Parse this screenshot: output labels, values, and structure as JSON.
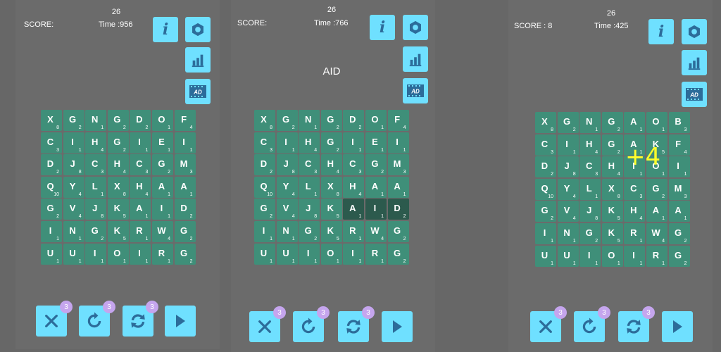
{
  "screens": [
    {
      "level": "26",
      "score": "SCORE:",
      "time": "Time :956",
      "word": "",
      "badges": {
        "clear": "3",
        "undo": "3",
        "shuffle": "3"
      },
      "grid": [
        [
          [
            "X",
            "8"
          ],
          [
            "G",
            "2"
          ],
          [
            "N",
            "1"
          ],
          [
            "G",
            "2"
          ],
          [
            "D",
            "2"
          ],
          [
            "O",
            "1"
          ],
          [
            "F",
            "4"
          ]
        ],
        [
          [
            "C",
            "3"
          ],
          [
            "I",
            "1"
          ],
          [
            "H",
            "4"
          ],
          [
            "G",
            "2"
          ],
          [
            "I",
            "1"
          ],
          [
            "E",
            "1"
          ],
          [
            "I",
            "1"
          ]
        ],
        [
          [
            "D",
            "2"
          ],
          [
            "J",
            "8"
          ],
          [
            "C",
            "3"
          ],
          [
            "H",
            "4"
          ],
          [
            "C",
            "3"
          ],
          [
            "G",
            "2"
          ],
          [
            "M",
            "3"
          ]
        ],
        [
          [
            "Q",
            "10"
          ],
          [
            "Y",
            "4"
          ],
          [
            "L",
            "1"
          ],
          [
            "X",
            "8"
          ],
          [
            "H",
            "4"
          ],
          [
            "A",
            "1"
          ],
          [
            "A",
            "1"
          ]
        ],
        [
          [
            "G",
            "2"
          ],
          [
            "V",
            "4"
          ],
          [
            "J",
            "8"
          ],
          [
            "K",
            "5"
          ],
          [
            "A",
            "1"
          ],
          [
            "I",
            "1"
          ],
          [
            "D",
            "2"
          ]
        ],
        [
          [
            "I",
            "1"
          ],
          [
            "N",
            "1"
          ],
          [
            "G",
            "2"
          ],
          [
            "K",
            "5"
          ],
          [
            "R",
            "1"
          ],
          [
            "W",
            "4"
          ],
          [
            "G",
            "2"
          ]
        ],
        [
          [
            "U",
            "1"
          ],
          [
            "U",
            "1"
          ],
          [
            "I",
            "1"
          ],
          [
            "O",
            "1"
          ],
          [
            "I",
            "1"
          ],
          [
            "R",
            "1"
          ],
          [
            "G",
            "2"
          ]
        ]
      ]
    },
    {
      "level": "26",
      "score": "SCORE:",
      "time": "Time :766",
      "word": "AID",
      "badges": {
        "clear": "3",
        "undo": "3",
        "shuffle": "3"
      },
      "grid": [
        [
          [
            "X",
            "8"
          ],
          [
            "G",
            "2"
          ],
          [
            "N",
            "1"
          ],
          [
            "G",
            "2"
          ],
          [
            "D",
            "2"
          ],
          [
            "O",
            "1"
          ],
          [
            "F",
            "4"
          ]
        ],
        [
          [
            "C",
            "3"
          ],
          [
            "I",
            "1"
          ],
          [
            "H",
            "4"
          ],
          [
            "G",
            "2"
          ],
          [
            "I",
            "1"
          ],
          [
            "E",
            "1"
          ],
          [
            "I",
            "1"
          ]
        ],
        [
          [
            "D",
            "2"
          ],
          [
            "J",
            "8"
          ],
          [
            "C",
            "3"
          ],
          [
            "H",
            "4"
          ],
          [
            "C",
            "3"
          ],
          [
            "G",
            "2"
          ],
          [
            "M",
            "3"
          ]
        ],
        [
          [
            "Q",
            "10"
          ],
          [
            "Y",
            "4"
          ],
          [
            "L",
            "1"
          ],
          [
            "X",
            "8"
          ],
          [
            "H",
            "4"
          ],
          [
            "A",
            "1"
          ],
          [
            "A",
            "1"
          ]
        ],
        [
          [
            "G",
            "2"
          ],
          [
            "V",
            "4"
          ],
          [
            "J",
            "8"
          ],
          [
            "K",
            "5"
          ],
          [
            "A",
            "1",
            1
          ],
          [
            "I",
            "1",
            1
          ],
          [
            "D",
            "2",
            1
          ]
        ],
        [
          [
            "I",
            "1"
          ],
          [
            "N",
            "1"
          ],
          [
            "G",
            "2"
          ],
          [
            "K",
            "5"
          ],
          [
            "R",
            "1"
          ],
          [
            "W",
            "4"
          ],
          [
            "G",
            "2"
          ]
        ],
        [
          [
            "U",
            "1"
          ],
          [
            "U",
            "1"
          ],
          [
            "I",
            "1"
          ],
          [
            "O",
            "1"
          ],
          [
            "I",
            "1"
          ],
          [
            "R",
            "1"
          ],
          [
            "G",
            "2"
          ]
        ]
      ]
    },
    {
      "level": "26",
      "score": "SCORE : 8",
      "time": "Time :425",
      "word": "",
      "plus_text": "+4",
      "badges": {
        "clear": "3",
        "undo": "3",
        "shuffle": "3"
      },
      "grid": [
        [
          [
            "X",
            "8"
          ],
          [
            "G",
            "2"
          ],
          [
            "N",
            "1"
          ],
          [
            "G",
            "2"
          ],
          [
            "A",
            "1"
          ],
          [
            "O",
            "1"
          ],
          [
            "B",
            "3"
          ]
        ],
        [
          [
            "C",
            "3"
          ],
          [
            "I",
            "1"
          ],
          [
            "H",
            "4"
          ],
          [
            "G",
            "2"
          ],
          [
            "A",
            "1"
          ],
          [
            "K",
            "5"
          ],
          [
            "F",
            "4"
          ]
        ],
        [
          [
            "D",
            "2"
          ],
          [
            "J",
            "8"
          ],
          [
            "C",
            "3"
          ],
          [
            "H",
            "4"
          ],
          [
            "I",
            "1"
          ],
          [
            "O",
            "1"
          ],
          [
            "I",
            "1"
          ]
        ],
        [
          [
            "Q",
            "10"
          ],
          [
            "Y",
            "4"
          ],
          [
            "L",
            "1"
          ],
          [
            "X",
            "8"
          ],
          [
            "C",
            "3"
          ],
          [
            "G",
            "2"
          ],
          [
            "M",
            "3"
          ]
        ],
        [
          [
            "G",
            "2"
          ],
          [
            "V",
            "4"
          ],
          [
            "J",
            "8"
          ],
          [
            "K",
            "5"
          ],
          [
            "H",
            "4"
          ],
          [
            "A",
            "1"
          ],
          [
            "A",
            "1"
          ]
        ],
        [
          [
            "I",
            "1"
          ],
          [
            "N",
            "1"
          ],
          [
            "G",
            "2"
          ],
          [
            "K",
            "5"
          ],
          [
            "R",
            "1"
          ],
          [
            "W",
            "4"
          ],
          [
            "G",
            "2"
          ]
        ],
        [
          [
            "U",
            "1"
          ],
          [
            "U",
            "1"
          ],
          [
            "I",
            "1"
          ],
          [
            "O",
            "1"
          ],
          [
            "I",
            "1"
          ],
          [
            "R",
            "1"
          ],
          [
            "G",
            "2"
          ]
        ]
      ]
    }
  ],
  "icons": {
    "info": "i",
    "settings": "gear-icon",
    "stats": "bar-chart-icon",
    "ad": "AD",
    "clear": "close-icon",
    "undo": "undo-icon",
    "shuffle": "shuffle-icon",
    "play": "play-icon"
  },
  "colors": {
    "background": "#676767",
    "panel": "#6b6b6b",
    "tile": "#3f8f79",
    "tile_selected": "#2c5a4d",
    "button": "#6fe0ff",
    "icon": "#2c6c9a",
    "badge": "#c5a5ee",
    "plus": "#ffff2a"
  }
}
